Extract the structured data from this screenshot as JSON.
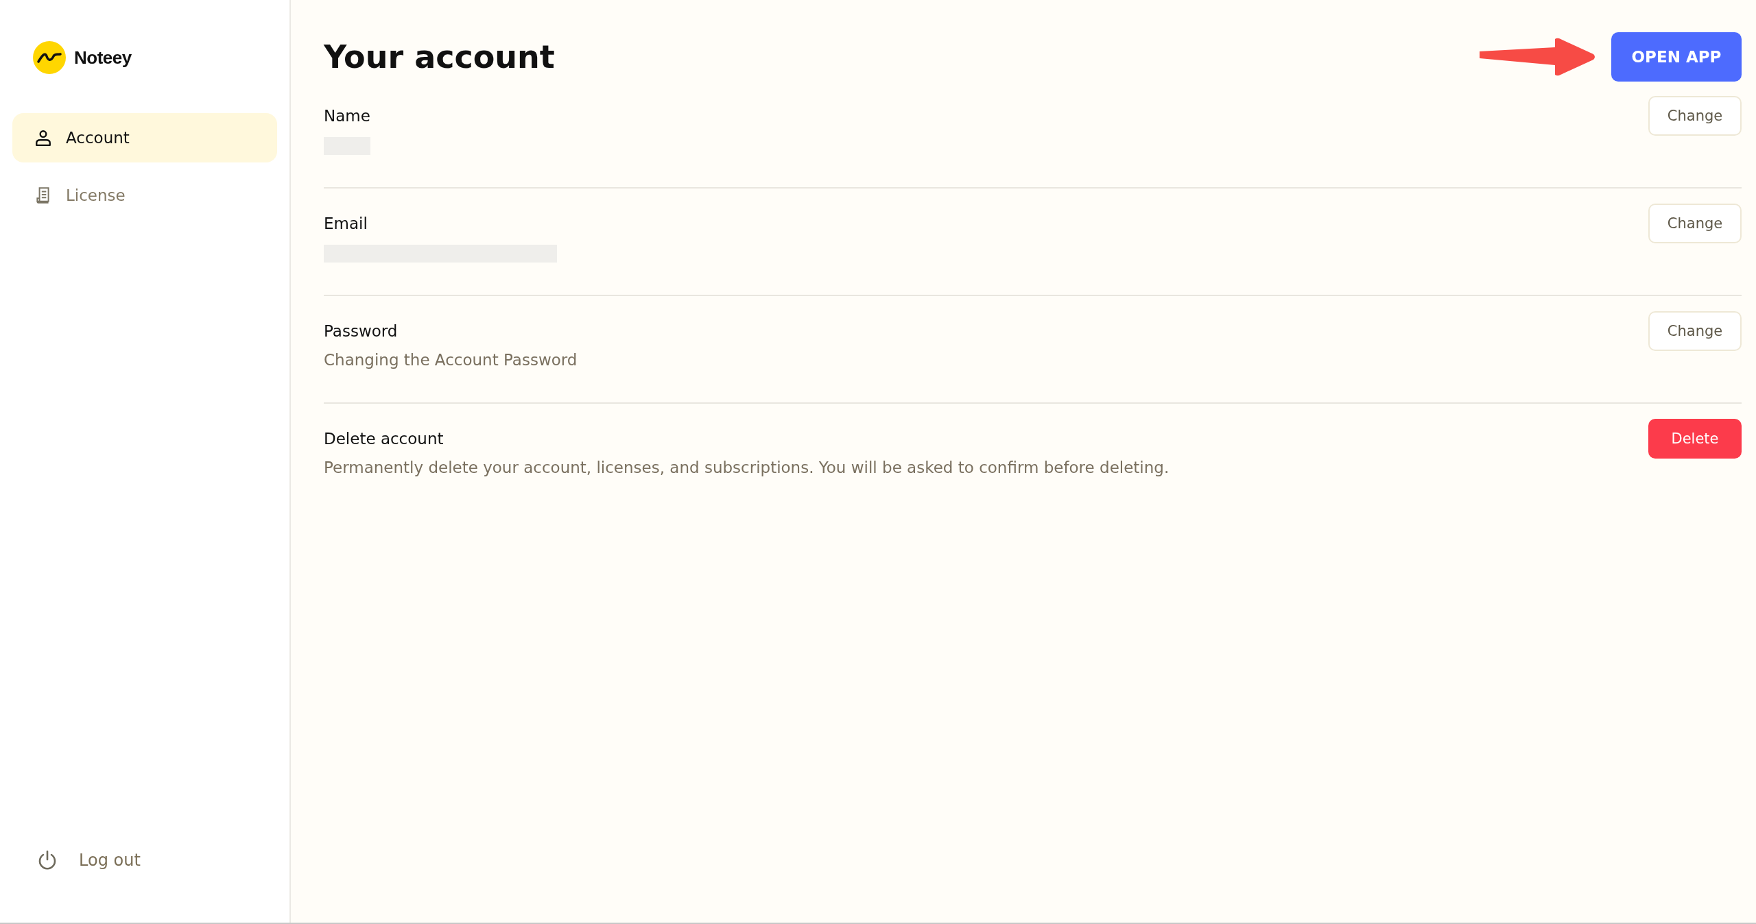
{
  "sidebar": {
    "brand": "Noteey",
    "items": [
      {
        "label": "Account",
        "selected": true
      },
      {
        "label": "License",
        "selected": false
      }
    ],
    "logout": "Log out"
  },
  "main": {
    "title": "Your account",
    "open_app_button": "OPEN APP",
    "sections": [
      {
        "label": "Name",
        "kind": "redacted",
        "button": {
          "label": "Change",
          "kind": "neutral"
        }
      },
      {
        "label": "Email",
        "kind": "redacted",
        "button": {
          "label": "Change",
          "kind": "neutral"
        }
      },
      {
        "label": "Password",
        "kind": "text",
        "value": "Changing the Account Password",
        "button": {
          "label": "Change",
          "kind": "neutral"
        }
      },
      {
        "label": "Delete account",
        "kind": "text",
        "value": "Permanently delete your account, licenses, and subscriptions. You will be asked to confirm before deleting.",
        "button": {
          "label": "Delete",
          "kind": "danger"
        }
      }
    ]
  }
}
